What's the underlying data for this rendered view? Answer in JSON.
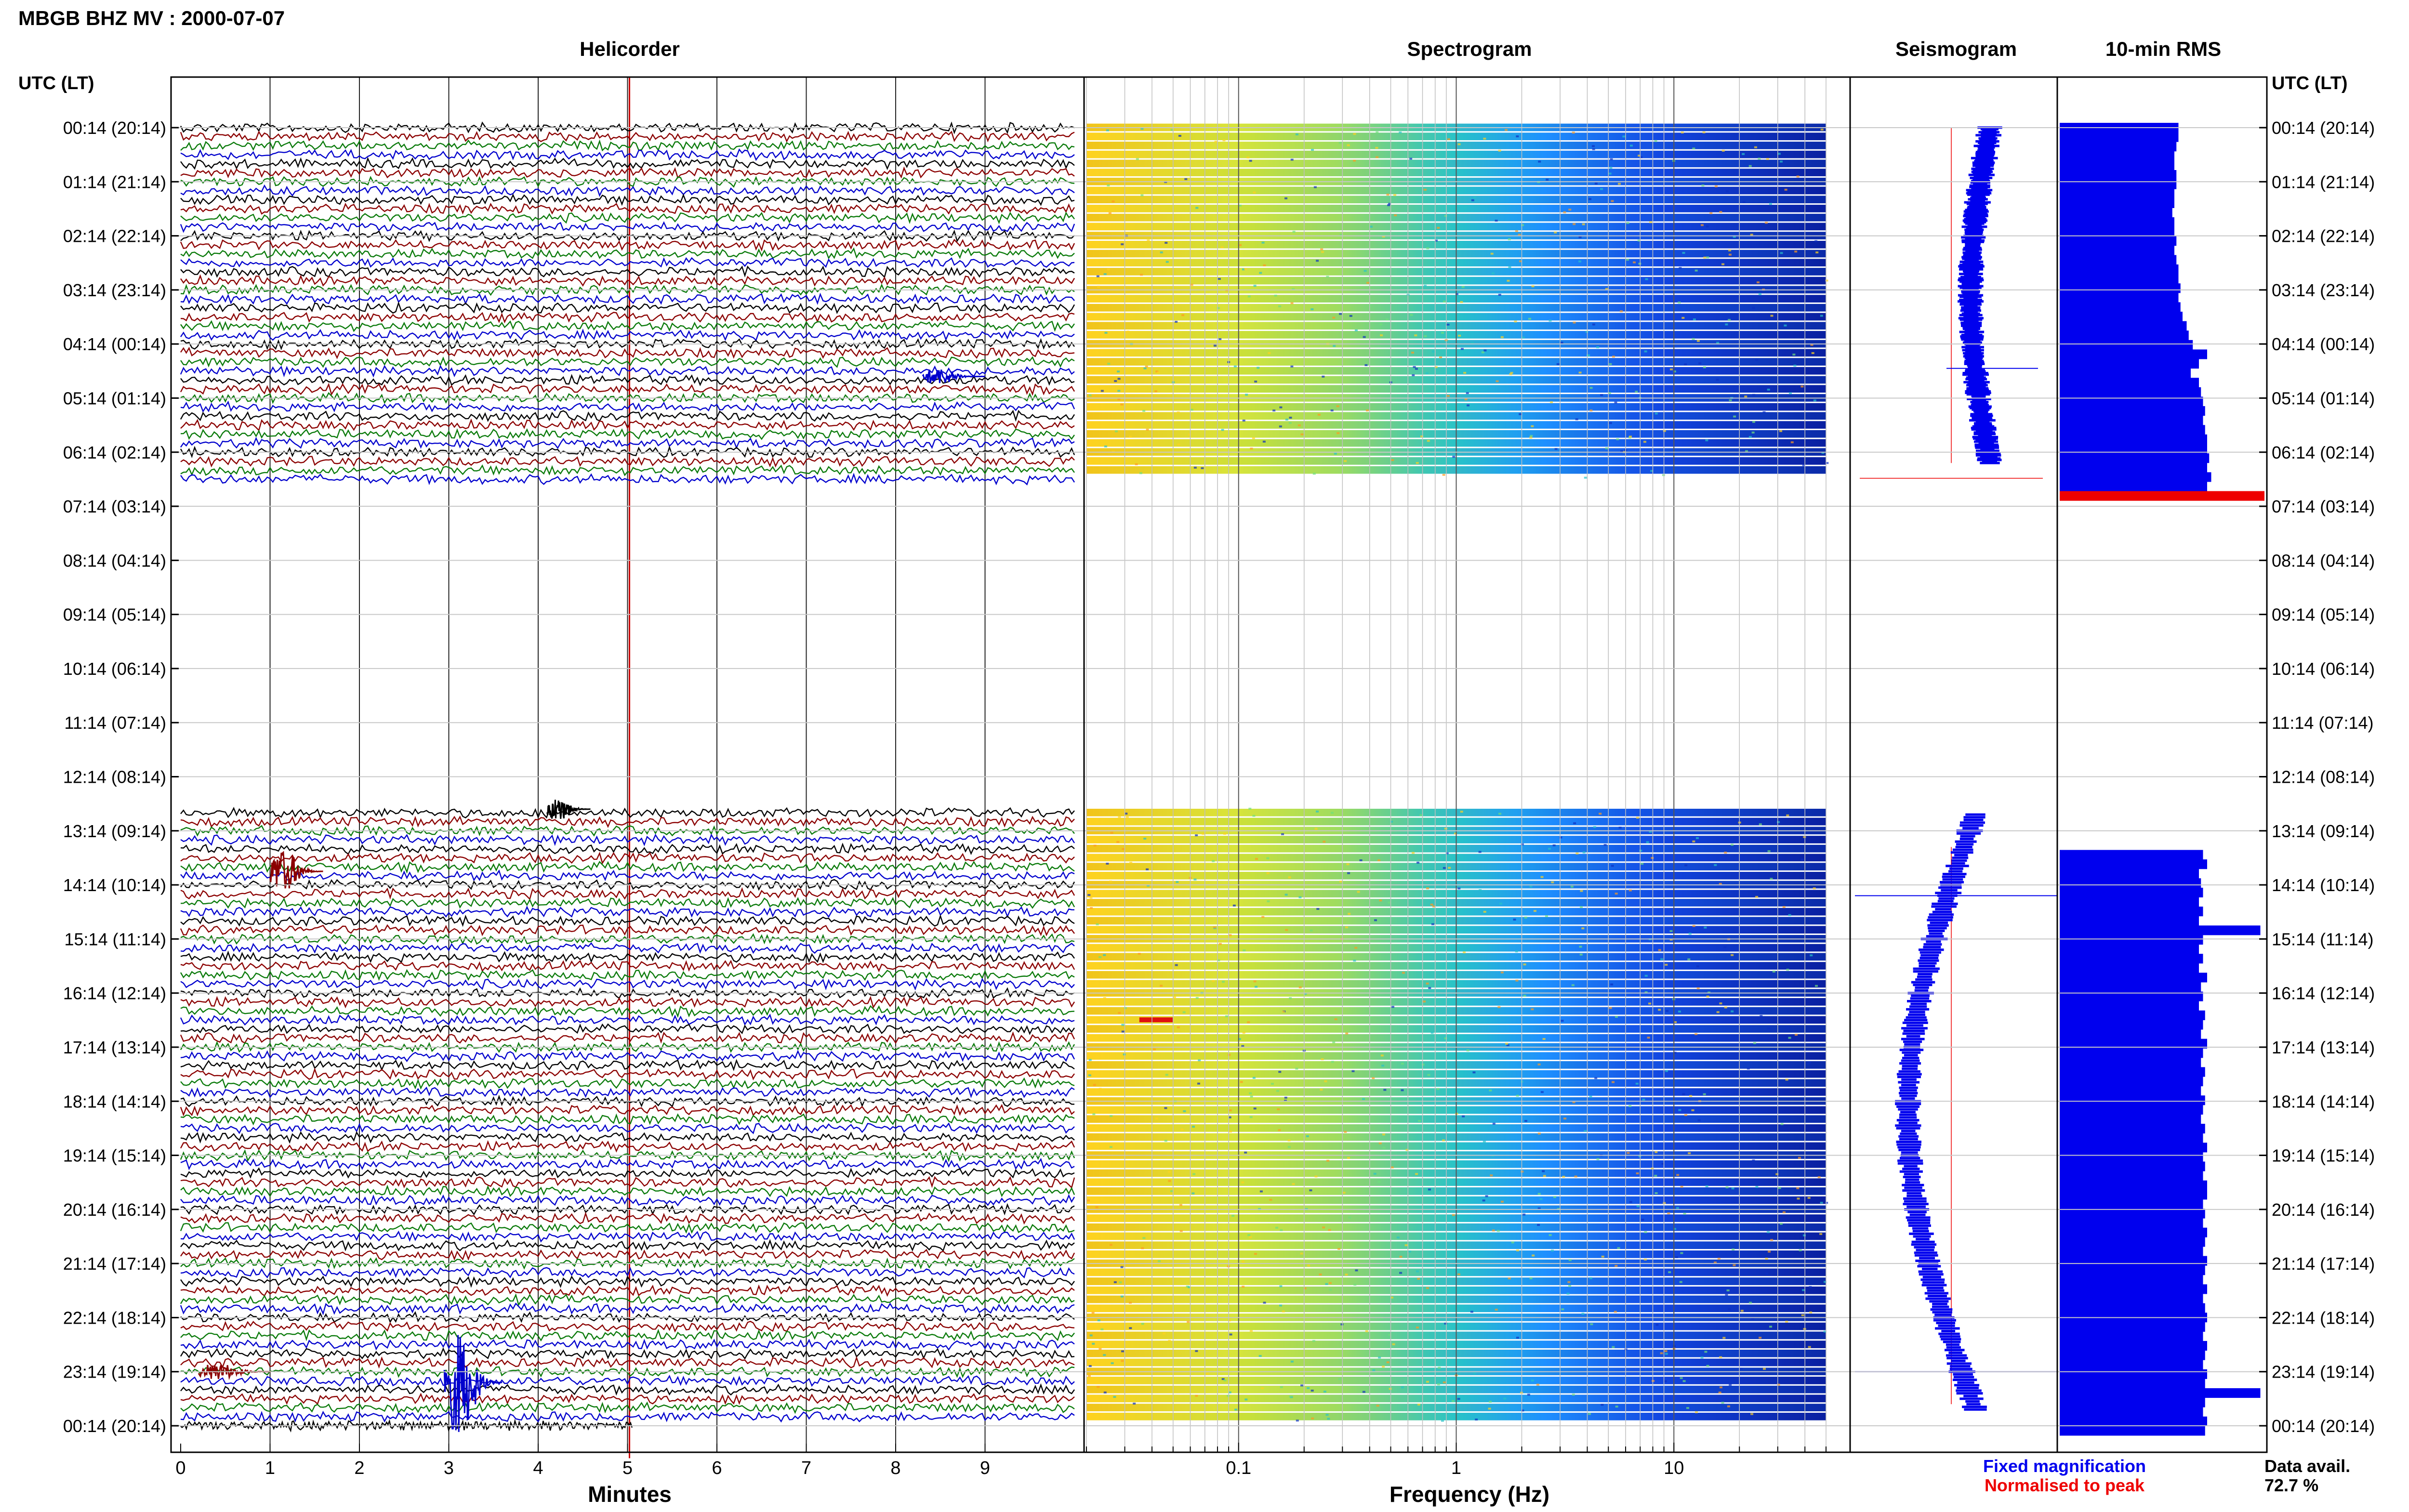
{
  "header": {
    "title": "MBGB BHZ MV : 2000-07-07"
  },
  "panels": {
    "helicorder": "Helicorder",
    "spectrogram": "Spectrogram",
    "seismogram": "Seismogram",
    "rms": "10-min RMS"
  },
  "axes": {
    "left_header": "UTC (LT)",
    "right_header": "UTC (LT)",
    "helicorder_xlabel": "Minutes",
    "spectrogram_xlabel": "Frequency (Hz)"
  },
  "legend": {
    "fixed": "Fixed magnification",
    "normalised": "Normalised to peak",
    "fixed_color": "#0000ee",
    "normalised_color": "#ee0000"
  },
  "availability": {
    "label": "Data avail.",
    "value": "72.7 %"
  },
  "chart_data": {
    "type": "helicorder",
    "time_labels": [
      "00:14 (20:14)",
      "01:14 (21:14)",
      "02:14 (22:14)",
      "03:14 (23:14)",
      "04:14 (00:14)",
      "05:14 (01:14)",
      "06:14 (02:14)",
      "07:14 (03:14)",
      "08:14 (04:14)",
      "09:14 (05:14)",
      "10:14 (06:14)",
      "11:14 (07:14)",
      "12:14 (08:14)",
      "13:14 (09:14)",
      "14:14 (10:14)",
      "15:14 (11:14)",
      "16:14 (12:14)",
      "17:14 (13:14)",
      "18:14 (14:14)",
      "19:14 (15:14)",
      "20:14 (16:14)",
      "21:14 (17:14)",
      "22:14 (18:14)",
      "23:14 (19:14)",
      "00:14 (20:14)"
    ],
    "time_range_hours": [
      0,
      24
    ],
    "helicorder_minutes_ticks": [
      "0",
      "1",
      "2",
      "3",
      "4",
      "5",
      "6",
      "7",
      "8",
      "9"
    ],
    "helicorder_xlim": [
      0,
      10
    ],
    "trace_colors": [
      "#000000",
      "#8b0000",
      "#0a7a0a",
      "#0000cd"
    ],
    "data_gap_hours": [
      6.5,
      12.7
    ],
    "spectrogram_ticks": [
      "0.1",
      "1",
      "10"
    ],
    "spectrogram_xlim": [
      0.02,
      50
    ],
    "spectrogram_colormap": "jet",
    "rms_values": [
      0.58,
      0.58,
      0.57,
      0.56,
      0.56,
      0.57,
      0.57,
      0.56,
      0.56,
      0.55,
      0.56,
      0.56,
      0.57,
      0.56,
      0.57,
      0.58,
      0.58,
      0.59,
      0.58,
      0.59,
      0.6,
      0.62,
      0.63,
      0.65,
      0.72,
      0.68,
      0.64,
      0.68,
      0.69,
      0.7,
      0.71,
      0.7,
      0.71,
      0.72,
      0.72,
      0.73,
      0.72,
      0.74,
      0.72,
      1.0,
      null,
      null,
      null,
      null,
      null,
      null,
      null,
      null,
      null,
      null,
      null,
      null,
      null,
      null,
      null,
      null,
      null,
      null,
      null,
      null,
      null,
      null,
      null,
      null,
      null,
      null,
      null,
      null,
      null,
      null,
      null,
      null,
      null,
      null,
      null,
      null,
      null,
      0.7,
      0.72,
      0.68,
      0.69,
      0.7,
      0.68,
      0.7,
      0.68,
      0.98,
      0.7,
      0.68,
      0.7,
      0.68,
      0.72,
      0.69,
      0.7,
      0.68,
      0.71,
      0.7,
      0.69,
      0.72,
      0.7,
      0.69,
      0.71,
      0.7,
      0.69,
      0.71,
      0.7,
      0.69,
      0.71,
      0.7,
      0.72,
      0.7,
      0.71,
      0.7,
      0.72,
      0.72,
      0.7,
      0.71,
      0.7,
      0.72,
      0.71,
      0.7,
      0.72,
      0.71,
      0.7,
      0.72,
      0.7,
      0.71,
      0.72,
      0.71,
      0.7,
      0.72,
      0.71,
      0.7,
      0.72,
      0.71,
      0.98,
      0.71,
      0.7,
      0.72,
      0.71
    ],
    "rms_highlight_index": 39,
    "seismogram_fixed_color": "#0000ee",
    "seismogram_normalised_color": "#ee0000"
  }
}
